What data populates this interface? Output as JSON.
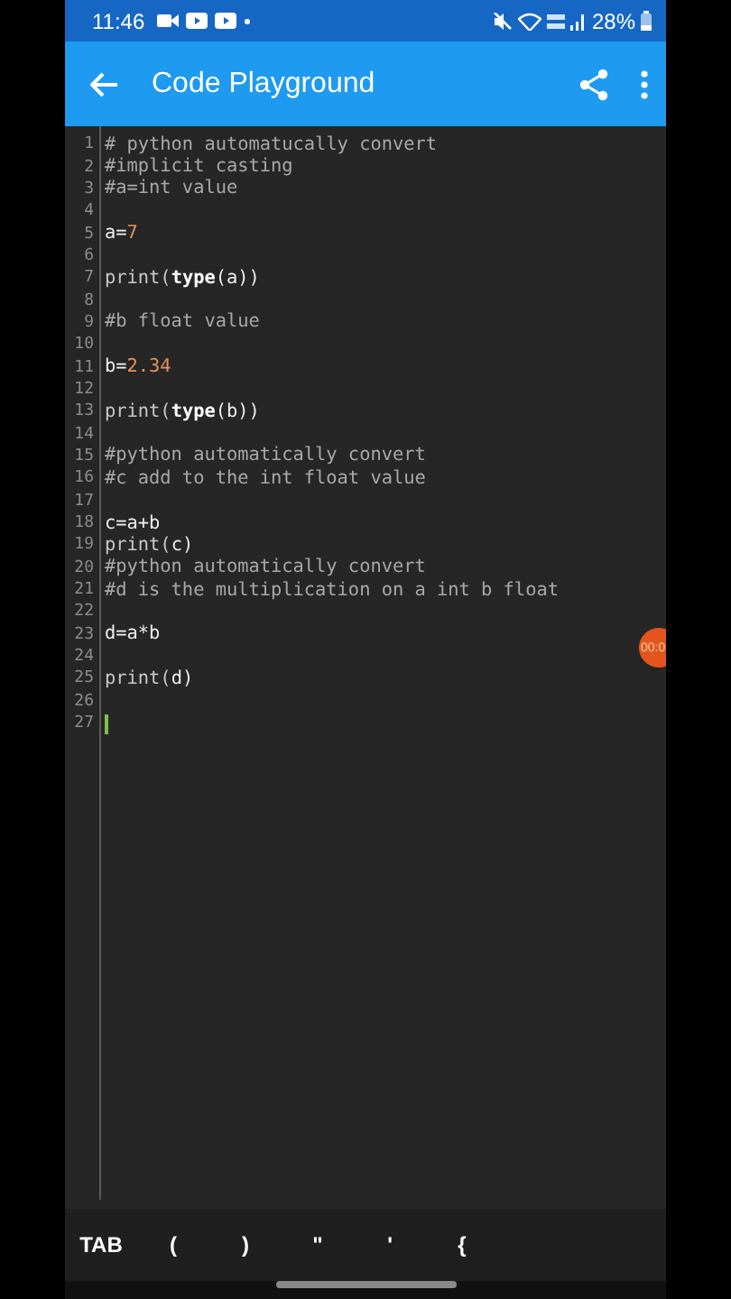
{
  "status_bar": {
    "time": "11:46",
    "battery": "28%"
  },
  "app_bar": {
    "title": "Code Playground"
  },
  "editor": {
    "lines": [
      {
        "number": "1",
        "cursor": false,
        "tokens": [
          {
            "text": "# python automatucally convert",
            "kind": "comment"
          }
        ]
      },
      {
        "number": "2",
        "cursor": false,
        "tokens": [
          {
            "text": "#implicit casting",
            "kind": "comment"
          }
        ]
      },
      {
        "number": "3",
        "cursor": false,
        "tokens": [
          {
            "text": "#a=int value",
            "kind": "comment"
          }
        ]
      },
      {
        "number": "4",
        "cursor": false
      },
      {
        "number": "5",
        "cursor": false,
        "tokens": [
          {
            "text": "a=",
            "kind": "plain"
          },
          {
            "text": "7",
            "kind": "number"
          }
        ]
      },
      {
        "number": "6",
        "cursor": false
      },
      {
        "number": "7",
        "cursor": false,
        "tokens": [
          {
            "text": "print(",
            "kind": "call"
          },
          {
            "text": "type",
            "kind": "builtin"
          },
          {
            "text": "(a))",
            "kind": "plain"
          }
        ]
      },
      {
        "number": "8",
        "cursor": false
      },
      {
        "number": "9",
        "cursor": false,
        "tokens": [
          {
            "text": "#b float value",
            "kind": "comment"
          }
        ]
      },
      {
        "number": "10",
        "cursor": false
      },
      {
        "number": "11",
        "cursor": false,
        "tokens": [
          {
            "text": "b=",
            "kind": "plain"
          },
          {
            "text": "2.34",
            "kind": "number"
          }
        ]
      },
      {
        "number": "12",
        "cursor": false
      },
      {
        "number": "13",
        "cursor": false,
        "tokens": [
          {
            "text": "print(",
            "kind": "call"
          },
          {
            "text": "type",
            "kind": "builtin"
          },
          {
            "text": "(b))",
            "kind": "plain"
          }
        ]
      },
      {
        "number": "14",
        "cursor": false
      },
      {
        "number": "15",
        "cursor": false,
        "tokens": [
          {
            "text": "#python automatically convert",
            "kind": "comment"
          }
        ]
      },
      {
        "number": "16",
        "cursor": false,
        "tokens": [
          {
            "text": "#c add to the int float value",
            "kind": "comment"
          }
        ]
      },
      {
        "number": "17",
        "cursor": false
      },
      {
        "number": "18",
        "cursor": false,
        "tokens": [
          {
            "text": "c=a+b",
            "kind": "plain"
          }
        ]
      },
      {
        "number": "19",
        "cursor": false,
        "tokens": [
          {
            "text": "print(",
            "kind": "call"
          },
          {
            "text": "c)",
            "kind": "plain"
          }
        ]
      },
      {
        "number": "20",
        "cursor": false,
        "tokens": [
          {
            "text": "#python automatically convert",
            "kind": "comment"
          }
        ]
      },
      {
        "number": "21",
        "cursor": false,
        "tokens": [
          {
            "text": "#d is the multiplication on a int b float",
            "kind": "comment"
          }
        ]
      },
      {
        "number": "22",
        "cursor": false
      },
      {
        "number": "23",
        "cursor": false,
        "tokens": [
          {
            "text": "d=a*b",
            "kind": "plain"
          }
        ]
      },
      {
        "number": "24",
        "cursor": false
      },
      {
        "number": "25",
        "cursor": false,
        "tokens": [
          {
            "text": "print(",
            "kind": "call"
          },
          {
            "text": "d)",
            "kind": "plain"
          }
        ]
      },
      {
        "number": "26",
        "cursor": false
      },
      {
        "number": "27",
        "cursor": true
      }
    ]
  },
  "recorder_badge": {
    "text": "00:0"
  },
  "key_bar": {
    "keys": [
      "TAB",
      "(",
      ")",
      "\"",
      "'",
      "{"
    ]
  }
}
